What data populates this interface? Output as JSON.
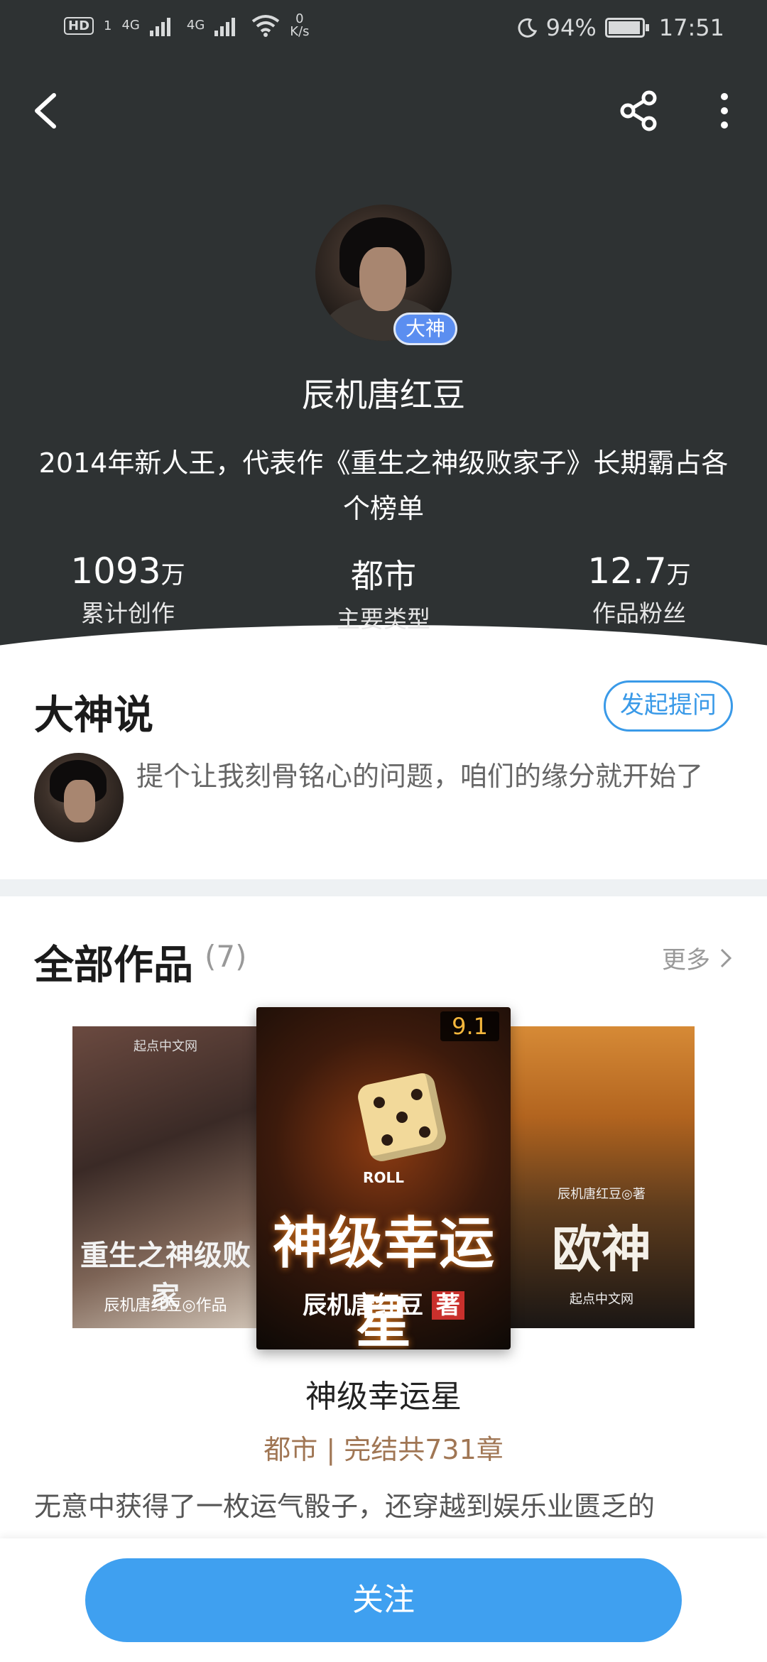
{
  "status_bar": {
    "hd": "HD",
    "sim_num": "1",
    "net1": "4G",
    "net2": "4G",
    "speed_value": "0",
    "speed_unit": "K/s",
    "battery": "94%",
    "time": "17:51"
  },
  "author": {
    "badge": "大神",
    "name": "辰机唐红豆",
    "intro": "2014年新人王，代表作《重生之神级败家子》长期霸占各个榜单"
  },
  "stats": [
    {
      "value": "1093",
      "unit": "万",
      "label": "累计创作"
    },
    {
      "value": "都市",
      "unit": "",
      "label": "主要类型"
    },
    {
      "value": "12.7",
      "unit": "万",
      "label": "作品粉丝"
    }
  ],
  "dashen_say": {
    "title": "大神说",
    "ask_button": "发起提问",
    "prompt": "提个让我刻骨铭心的问题，咱们的缘分就开始了"
  },
  "works": {
    "title": "全部作品",
    "count": "(7)",
    "more": "更多",
    "featured": {
      "rating": "9.1",
      "cover_title": "神级幸运星",
      "cover_author": "辰机唐红豆",
      "cover_tag": "著",
      "roll": "ROLL",
      "title": "神级幸运星",
      "meta": "都市 | 完结共731章",
      "desc": "无意中获得了一枚运气骰子，还穿越到娱乐业匮乏的"
    },
    "left_cover": {
      "brand": "起点中文网",
      "title": "重生之神级败家",
      "author": "辰机唐红豆◎作品"
    },
    "right_cover": {
      "author": "辰机唐红豆◎著",
      "title": "欧神",
      "brand": "起点中文网"
    }
  },
  "follow_button": "关注",
  "colors": {
    "header_bg": "#2e3233",
    "accent": "#3fa0f0",
    "meta": "#a07654"
  }
}
